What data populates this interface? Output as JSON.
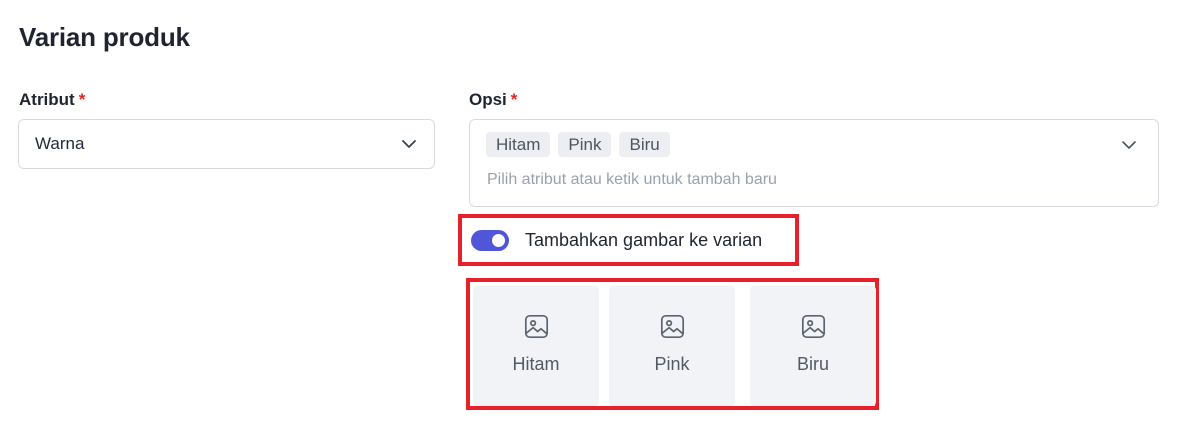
{
  "section": {
    "title": "Varian produk"
  },
  "attribute": {
    "label": "Atribut",
    "required_mark": "*",
    "value": "Warna",
    "icon": "chevron-down-icon"
  },
  "options": {
    "label": "Opsi",
    "required_mark": "*",
    "chips": [
      "Hitam",
      "Pink",
      "Biru"
    ],
    "placeholder": "Pilih atribut atau ketik untuk tambah baru",
    "icon": "chevron-down-icon"
  },
  "image_toggle": {
    "label": "Tambahkan gambar ke varian",
    "enabled": true,
    "color": "#4f56d8"
  },
  "variant_images": [
    {
      "name": "Hitam",
      "icon": "image-icon"
    },
    {
      "name": "Pink",
      "icon": "image-icon"
    },
    {
      "name": "Biru",
      "icon": "image-icon"
    }
  ],
  "colors": {
    "highlight_border": "#e8202a",
    "required": "#dc2626"
  }
}
